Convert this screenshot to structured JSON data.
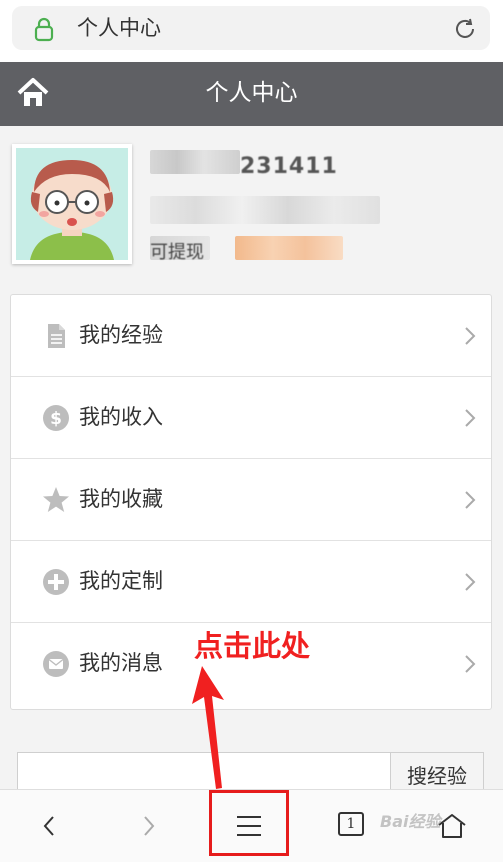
{
  "browser": {
    "url_title": "个人中心",
    "accent": "#4caf50"
  },
  "header": {
    "title": "个人中心",
    "background": "#5f6064"
  },
  "profile": {
    "username_partial": "231411",
    "tag_prefix": "可提现"
  },
  "menu": {
    "items": [
      {
        "label": "我的经验",
        "icon": "document-icon"
      },
      {
        "label": "我的收入",
        "icon": "dollar-icon"
      },
      {
        "label": "我的收藏",
        "icon": "star-icon"
      },
      {
        "label": "我的定制",
        "icon": "plus-circle-icon"
      },
      {
        "label": "我的消息",
        "icon": "envelope-icon"
      }
    ]
  },
  "annotation": {
    "text": "点击此处",
    "color": "#f02020"
  },
  "search": {
    "placeholder": "",
    "button_label": "搜经验"
  },
  "bottom_nav": {
    "tab_count": "1",
    "watermark": "Bai经验"
  }
}
